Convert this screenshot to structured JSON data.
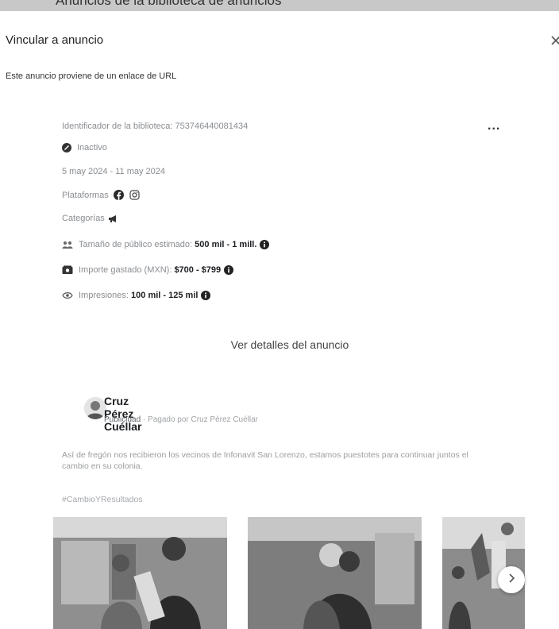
{
  "top_bar": {
    "text": "Anuncios de la biblioteca de anuncios"
  },
  "modal": {
    "title": "Vincular a anuncio",
    "close_icon": "close-icon",
    "source_note": "Este anuncio proviene de un enlace de URL"
  },
  "ad": {
    "library_id": "Identificador de la biblioteca: 753746440081434",
    "status": "Inactivo",
    "date_range": "5 may 2024 - 11 may 2024",
    "platforms_label": "Plataformas",
    "platform_icons": [
      "facebook-icon",
      "instagram-icon"
    ],
    "categories_label": "Categorías",
    "category_icon": "megaphone-icon",
    "audience_label": "Tamaño de público estimado:",
    "audience_value": "500 mil - 1 mill.",
    "spend_label": "Importe gastado (MXN):",
    "spend_value": "$700 - $799",
    "impressions_label": "Impresiones:",
    "impressions_value": "100 mil - 125 mil",
    "more_options": "...",
    "details_button": "Ver detalles del anuncio"
  },
  "post": {
    "advertiser": "Cruz Pérez Cuéllar",
    "sponsored_label": "Publicidad",
    "paid_by": " · Pagado por Cruz Pérez Cuéllar",
    "body": "Así de fregón nos recibieron los vecinos de Infonavit San Lorenzo, estamos puestotes para continuar juntos el cambio en su colonia.",
    "hashtag": "#CambioYResultados",
    "carousel_next_icon": "chevron-right-icon"
  },
  "colors": {
    "muted_text": "#8a8d91",
    "strong_text": "#1c1e21",
    "top_bar": "#c8c8c8"
  }
}
